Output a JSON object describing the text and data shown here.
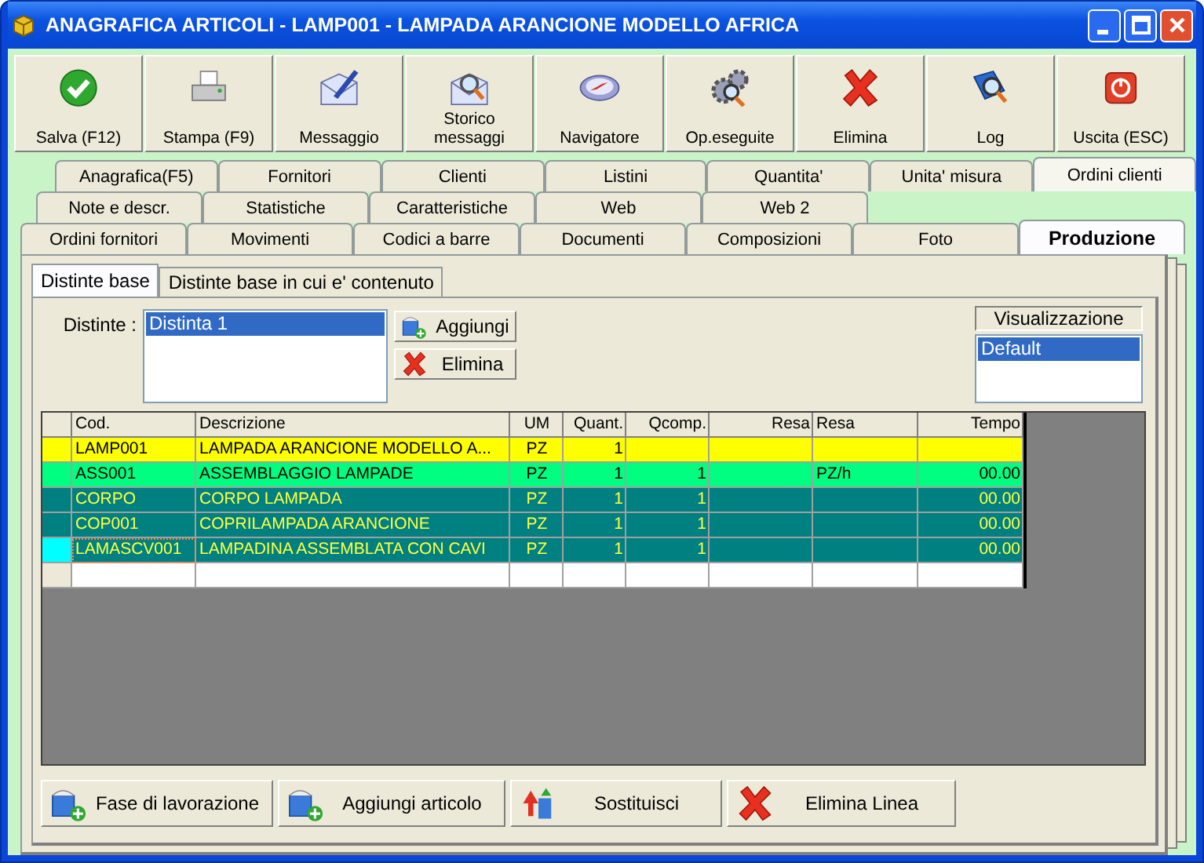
{
  "window": {
    "title": "ANAGRAFICA ARTICOLI - LAMP001 - LAMPADA ARANCIONE MODELLO AFRICA"
  },
  "toolbar": [
    {
      "label": "Salva (F12)",
      "kind": "check"
    },
    {
      "label": "Stampa (F9)",
      "kind": "printer"
    },
    {
      "label": "Messaggio",
      "kind": "pen"
    },
    {
      "label": "Storico messaggi",
      "kind": "envsearch"
    },
    {
      "label": "Navigatore",
      "kind": "compass"
    },
    {
      "label": "Op.eseguite",
      "kind": "gears"
    },
    {
      "label": "Elimina",
      "kind": "cross"
    },
    {
      "label": "Log",
      "kind": "book"
    },
    {
      "label": "Uscita (ESC)",
      "kind": "power"
    }
  ],
  "tab_rows": [
    [
      {
        "label": "Anagrafica(F5)",
        "selected": false,
        "hot": false
      },
      {
        "label": "Fornitori",
        "selected": false,
        "hot": false
      },
      {
        "label": "Clienti",
        "selected": false,
        "hot": false
      },
      {
        "label": "Listini",
        "selected": false,
        "hot": false
      },
      {
        "label": "Quantita'",
        "selected": false,
        "hot": false
      },
      {
        "label": "Unita' misura",
        "selected": false,
        "hot": false
      },
      {
        "label": "Ordini clienti",
        "selected": false,
        "hot": true
      }
    ],
    [
      {
        "label": "Note e descr.",
        "selected": false,
        "hot": false
      },
      {
        "label": "Statistiche",
        "selected": false,
        "hot": false
      },
      {
        "label": "Caratteristiche",
        "selected": false,
        "hot": false
      },
      {
        "label": "Web",
        "selected": false,
        "hot": false
      },
      {
        "label": "Web 2",
        "selected": false,
        "hot": false
      }
    ],
    [
      {
        "label": "Ordini fornitori",
        "selected": false,
        "hot": false
      },
      {
        "label": "Movimenti",
        "selected": false,
        "hot": false
      },
      {
        "label": "Codici a barre",
        "selected": false,
        "hot": false
      },
      {
        "label": "Documenti",
        "selected": false,
        "hot": false
      },
      {
        "label": "Composizioni",
        "selected": false,
        "hot": false
      },
      {
        "label": "Foto",
        "selected": false,
        "hot": false
      },
      {
        "label": "Produzione",
        "selected": true,
        "hot": false
      }
    ]
  ],
  "subtabs": [
    {
      "label": "Distinte base",
      "selected": true
    },
    {
      "label": "Distinte base in cui e' contenuto",
      "selected": false
    }
  ],
  "distinte": {
    "label": "Distinte :",
    "items": [
      {
        "label": "Distinta 1",
        "selected": true
      }
    ],
    "buttons": [
      {
        "label": "Aggiungi",
        "kind": "add"
      },
      {
        "label": "Elimina",
        "kind": "cross"
      }
    ]
  },
  "visualizzazione": {
    "title": "Visualizzazione",
    "items": [
      {
        "label": "Default",
        "selected": true
      }
    ]
  },
  "table": {
    "columns": [
      {
        "label": "Cod."
      },
      {
        "label": "Descrizione"
      },
      {
        "label": "UM"
      },
      {
        "label": "Quant."
      },
      {
        "label": "Qcomp."
      },
      {
        "label": "Resa"
      },
      {
        "label": "Resa"
      },
      {
        "label": "Tempo"
      }
    ],
    "rows": [
      {
        "kind": "article",
        "selected": false,
        "cells": [
          "LAMP001",
          "LAMPADA ARANCIONE MODELLO A...",
          "PZ",
          "1",
          "",
          "",
          "",
          ""
        ]
      },
      {
        "kind": "phase",
        "selected": false,
        "cells": [
          "ASS001",
          "ASSEMBLAGGIO LAMPADE",
          "PZ",
          "1",
          "1",
          "",
          "PZ/h",
          "00.00"
        ]
      },
      {
        "kind": "component",
        "selected": false,
        "cells": [
          "CORPO",
          "CORPO LAMPADA",
          "PZ",
          "1",
          "1",
          "",
          "",
          "00.00"
        ]
      },
      {
        "kind": "component",
        "selected": false,
        "cells": [
          "COP001",
          "COPRILAMPADA ARANCIONE",
          "PZ",
          "1",
          "1",
          "",
          "",
          "00.00"
        ]
      },
      {
        "kind": "component",
        "selected": true,
        "cells": [
          "LAMASCV001",
          "LAMPADINA ASSEMBLATA CON CAVI",
          "PZ",
          "1",
          "1",
          "",
          "",
          "00.00"
        ]
      }
    ]
  },
  "bottom_buttons": [
    {
      "label": "Fase di lavorazione",
      "kind": "add"
    },
    {
      "label": "Aggiungi articolo",
      "kind": "add"
    },
    {
      "label": "Sostituisci",
      "kind": "swap"
    },
    {
      "label": "Elimina Linea",
      "kind": "cross"
    }
  ]
}
